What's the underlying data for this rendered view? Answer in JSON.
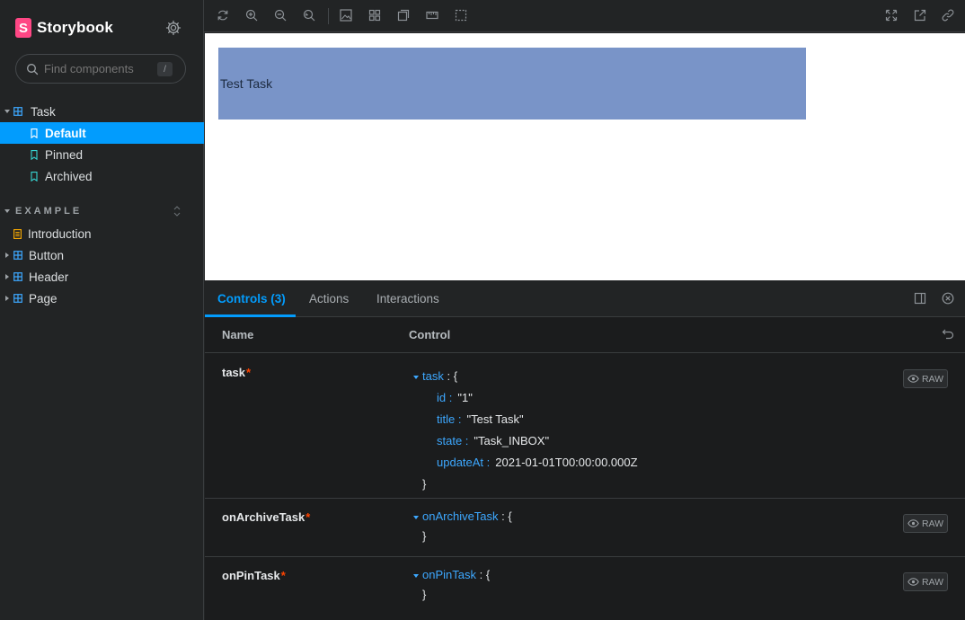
{
  "brand": {
    "logo_letter": "S",
    "name": "Storybook"
  },
  "search": {
    "placeholder": "Find components",
    "shortcut": "/"
  },
  "sidebar": {
    "task_group": "Task",
    "stories": [
      {
        "label": "Default",
        "selected": true
      },
      {
        "label": "Pinned",
        "selected": false
      },
      {
        "label": "Archived",
        "selected": false
      }
    ],
    "section_title": "EXAMPLE",
    "example_items": [
      {
        "label": "Introduction",
        "type": "doc"
      },
      {
        "label": "Button",
        "type": "component"
      },
      {
        "label": "Header",
        "type": "component"
      },
      {
        "label": "Page",
        "type": "component"
      }
    ]
  },
  "toolbar": {
    "left_icons": [
      "reload-icon",
      "zoom-in-icon",
      "zoom-out-icon",
      "zoom-reset-icon",
      "background-icon",
      "grid-icon",
      "viewport-icon",
      "measure-icon",
      "outline-icon"
    ],
    "right_icons": [
      "fullscreen-icon",
      "open-new-tab-icon",
      "copy-link-icon"
    ]
  },
  "canvas": {
    "task_title": "Test Task",
    "task_bg": "#7994c8"
  },
  "panel": {
    "tabs": [
      "Controls (3)",
      "Actions",
      "Interactions"
    ],
    "active_tab": "Controls (3)",
    "columns": {
      "name": "Name",
      "control": "Control"
    },
    "raw_label": "RAW",
    "required_marker": "*",
    "rows": [
      {
        "name": "task",
        "key": "task",
        "open": ": {",
        "close": "}",
        "fields": [
          {
            "key": "id :",
            "value": "\"1\""
          },
          {
            "key": "title :",
            "value": "\"Test Task\""
          },
          {
            "key": "state :",
            "value": "\"Task_INBOX\""
          },
          {
            "key": "updateAt :",
            "value": "2021-01-01T00:00:00.000Z"
          }
        ]
      },
      {
        "name": "onArchiveTask",
        "key": "onArchiveTask",
        "open": ": {",
        "close": "}"
      },
      {
        "name": "onPinTask",
        "key": "onPinTask",
        "open": ": {",
        "close": "}"
      }
    ]
  },
  "colors": {
    "accent": "#029cfd",
    "required": "#ff4400",
    "brand": "#ff4785"
  }
}
